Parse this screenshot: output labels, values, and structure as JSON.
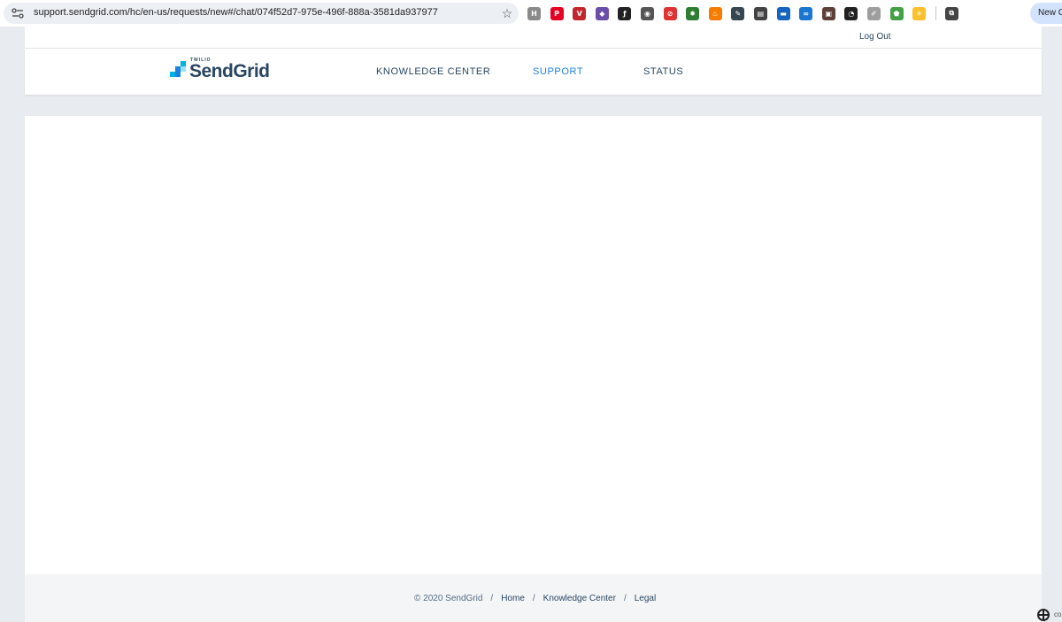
{
  "browser": {
    "url": "support.sendgrid.com/hc/en-us/requests/new#/chat/074f52d7-975e-496f-888a-3581da937977",
    "new_chat_label": "New Ch",
    "extensions": [
      {
        "name": "h-extension-icon",
        "glyph": "H",
        "color": "#8a8a8a"
      },
      {
        "name": "pinterest-icon",
        "glyph": "P",
        "color": "#e60023"
      },
      {
        "name": "v-extension-icon",
        "glyph": "V",
        "color": "#c1272d"
      },
      {
        "name": "puzzle-robot-icon",
        "glyph": "◆",
        "color": "#6b4ea8"
      },
      {
        "name": "fp-extension-icon",
        "glyph": "ƒ",
        "color": "#222222"
      },
      {
        "name": "location-pin-icon",
        "glyph": "◉",
        "color": "#555555"
      },
      {
        "name": "block-icon",
        "glyph": "⊘",
        "color": "#d33"
      },
      {
        "name": "gear-extension-icon",
        "glyph": "✹",
        "color": "#2e7d32"
      },
      {
        "name": "fire-icon",
        "glyph": "♨",
        "color": "#f57c00"
      },
      {
        "name": "tag-icon",
        "glyph": "✎",
        "color": "#37474f"
      },
      {
        "name": "document-icon",
        "glyph": "▤",
        "color": "#424242"
      },
      {
        "name": "car-icon",
        "glyph": "▬",
        "color": "#1565c0"
      },
      {
        "name": "link-icon",
        "glyph": "∞",
        "color": "#1976d2"
      },
      {
        "name": "book-icon",
        "glyph": "▣",
        "color": "#5d4037"
      },
      {
        "name": "gauge-icon",
        "glyph": "◔",
        "color": "#212121"
      },
      {
        "name": "pen-icon",
        "glyph": "✐",
        "color": "#9e9e9e"
      },
      {
        "name": "shield-extension-icon",
        "glyph": "⬟",
        "color": "#43a047"
      },
      {
        "name": "sun-icon",
        "glyph": "✳",
        "color": "#fbc02d"
      },
      {
        "name": "extensions-puzzle-icon",
        "glyph": "⧉",
        "color": "#444444"
      }
    ]
  },
  "header": {
    "logout_label": "Log Out",
    "logo_small": "TWILIO",
    "logo_text": "SendGrid",
    "nav": {
      "knowledge": "KNOWLEDGE CENTER",
      "support": "SUPPORT",
      "status": "STATUS"
    },
    "active_color": "#1a82e2",
    "brand_color": "#294661"
  },
  "footer": {
    "copyright": "© 2020 SendGrid",
    "sep": "/",
    "home": "Home",
    "knowledge": "Knowledge Center",
    "legal": "Legal"
  },
  "corner_text": "co"
}
